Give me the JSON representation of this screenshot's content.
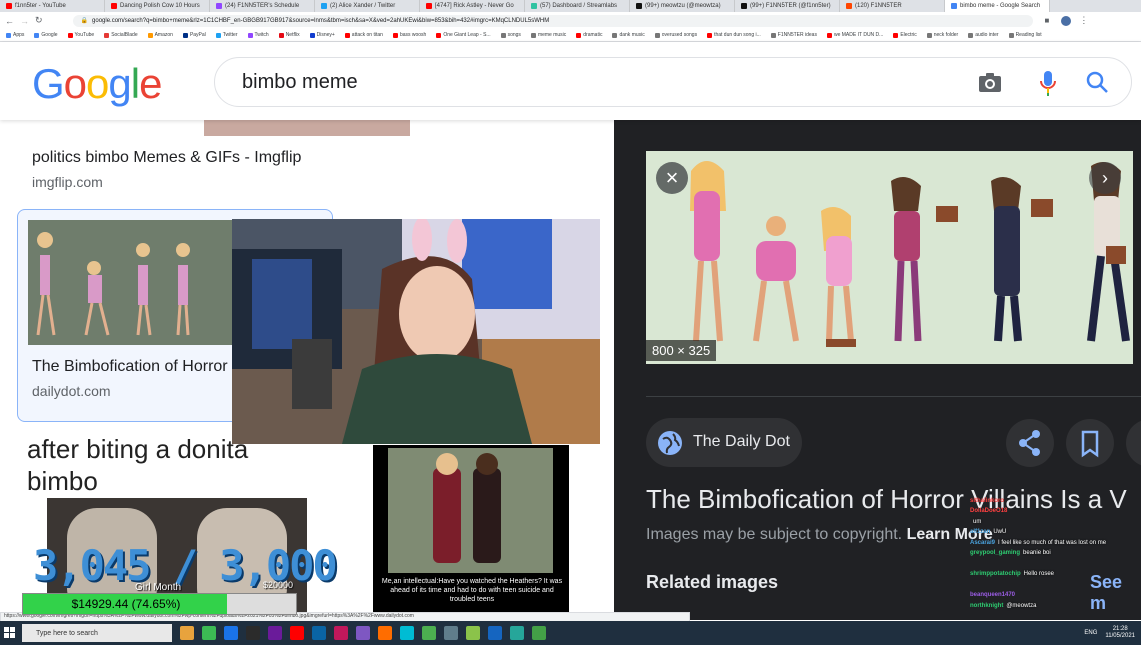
{
  "browser": {
    "tabs": [
      {
        "label": "f1nn5ter - YouTube",
        "color": "#ff0000"
      },
      {
        "label": "Dancing Polish Cow 10 Hours",
        "color": "#ff0000"
      },
      {
        "label": "(24) F1NN5TER's Schedule",
        "color": "#9146ff"
      },
      {
        "label": "(2) Alice Xander / Twitter",
        "color": "#1da1f2"
      },
      {
        "label": "[4747] Rick Astley - Never Go",
        "color": "#ff0000"
      },
      {
        "label": "(57) Dashboard / Streamlabs",
        "color": "#31c3a2"
      },
      {
        "label": "(99+) meowtzu (@meowtza)",
        "color": "#111111"
      },
      {
        "label": "(99+) F1NN5TER (@f1nn5ter)",
        "color": "#111111"
      },
      {
        "label": "(120) F1NN5TER",
        "color": "#ff4500"
      },
      {
        "label": "bimbo meme - Google Search",
        "color": "#4285f4"
      }
    ],
    "url": "google.com/search?q=bimbo+meme&rlz=1C1CHBF_en-GBGB917GB917&source=lnms&tbm=isch&sa=X&ved=2ahUKEwi&biw=853&bih=432#imgrc=KMqCLNDUL5sWHM",
    "bookmarks": [
      {
        "label": "Apps",
        "color": "#4285f4"
      },
      {
        "label": "Google",
        "color": "#4285f4"
      },
      {
        "label": "YouTube",
        "color": "#ff0000"
      },
      {
        "label": "SocialBlade",
        "color": "#e53935"
      },
      {
        "label": "Amazon",
        "color": "#ff9900"
      },
      {
        "label": "PayPal",
        "color": "#003087"
      },
      {
        "label": "Twitter",
        "color": "#1da1f2"
      },
      {
        "label": "Twitch",
        "color": "#9146ff"
      },
      {
        "label": "Netflix",
        "color": "#e50914"
      },
      {
        "label": "Disney+",
        "color": "#113ccf"
      },
      {
        "label": "attack on titan",
        "color": "#ff0000"
      },
      {
        "label": "bass woosh",
        "color": "#ff0000"
      },
      {
        "label": "One Giant Leap - S...",
        "color": "#ff0000"
      },
      {
        "label": "songs",
        "color": "#777777"
      },
      {
        "label": "meme music",
        "color": "#777777"
      },
      {
        "label": "dramatic",
        "color": "#ff0000"
      },
      {
        "label": "dank music",
        "color": "#777777"
      },
      {
        "label": "overused songs",
        "color": "#777777"
      },
      {
        "label": "that dun dun song i...",
        "color": "#ff0000"
      },
      {
        "label": "F1NN5TER ideas",
        "color": "#777777"
      },
      {
        "label": "we MADE IT DUN D...",
        "color": "#ff0000"
      },
      {
        "label": "Electric",
        "color": "#ff0000"
      },
      {
        "label": "neck folder",
        "color": "#777777"
      },
      {
        "label": "audio inter",
        "color": "#777777"
      },
      {
        "label": "Reading list",
        "color": "#777777"
      }
    ]
  },
  "google": {
    "logo_letters": [
      {
        "ch": "G",
        "color": "#4285f4"
      },
      {
        "ch": "o",
        "color": "#ea4335"
      },
      {
        "ch": "o",
        "color": "#fbbc05"
      },
      {
        "ch": "g",
        "color": "#4285f4"
      },
      {
        "ch": "l",
        "color": "#34a853"
      },
      {
        "ch": "e",
        "color": "#ea4335"
      }
    ],
    "query": "bimbo meme"
  },
  "results": {
    "item1": {
      "title": "politics bimbo Memes & GIFs - Imgflip",
      "source": "imgflip.com"
    },
    "item2": {
      "title": "The Bimbofication of Horror",
      "source": "dailydot.com"
    },
    "meme1_text": "after biting a donita bimbo",
    "meme2_caption": "Me,an intellectual:Have you watched the Heathers? It was ahead of its time and had to do with teen suicide and troubled teens"
  },
  "panel": {
    "size": "800 × 325",
    "source": "The Daily Dot",
    "title": "The Bimbofication of Horror Villains Is a V",
    "copyright_prefix": "Images may be subject to copyright.",
    "learn_more": "Learn More",
    "related": "Related images",
    "see_more": "See m"
  },
  "overlay": {
    "counter": "3,045 / 3,000",
    "counter_caption": "Girl Month",
    "donation": "$14929.44 (74.65%)",
    "donation_fraction": 0.7465,
    "donation_goal": "$20000"
  },
  "chat": [
    {
      "user": "",
      "msg": "",
      "color": "#e25"
    },
    {
      "user": "sithalinkoro",
      "msg": "",
      "color": "#ff4040"
    },
    {
      "user": "DollaDoeO18",
      "msg": "",
      "color": "#ff4040"
    },
    {
      "user": "",
      "msg": "um",
      "color": "#9b5de5"
    },
    {
      "user": "alf1zan",
      "msg": "UwU",
      "color": "#4aa3df"
    },
    {
      "user": "Ascarai9",
      "msg": "I feel like so much of that was lost on me",
      "color": "#4aa3df"
    },
    {
      "user": "greypool_gaming",
      "msg": "beanie boi",
      "color": "#2ecc71"
    },
    {
      "user": "",
      "msg": "",
      "color": "#9b5de5"
    },
    {
      "user": "shrimppotatochip",
      "msg": "Hello rosee",
      "color": "#2ecc71"
    },
    {
      "user": "",
      "msg": "",
      "color": "#9b5de5"
    },
    {
      "user": "beanqueen1470",
      "msg": "",
      "color": "#9b5de5"
    },
    {
      "user": "northknight",
      "msg": "@meowtza",
      "color": "#2ecc71"
    }
  ],
  "taskbar": {
    "search_placeholder": "Type here to search",
    "lang": "ENG",
    "time": "21:28",
    "date": "11/05/2021",
    "icon_colors": [
      "#e8a33d",
      "#3cba54",
      "#1a73e8",
      "#2b2b2b",
      "#6a1b9a",
      "#ff0000",
      "#0a64a4",
      "#c2185b",
      "#7e57c2",
      "#ff6d00",
      "#00bcd4",
      "#4caf50",
      "#607d8b",
      "#8bc34a",
      "#1565c0",
      "#26a69a",
      "#43a047"
    ]
  },
  "status_url": "https://www.google.com/imgres?imgurl=https%3A%2F%2Fwww.dailydot.com%2Fwp-content%2Fuploads%2F2021%2F05%2Fbimbo.jpg&imgrefurl=https%3A%2F%2Fwww.dailydot.com"
}
